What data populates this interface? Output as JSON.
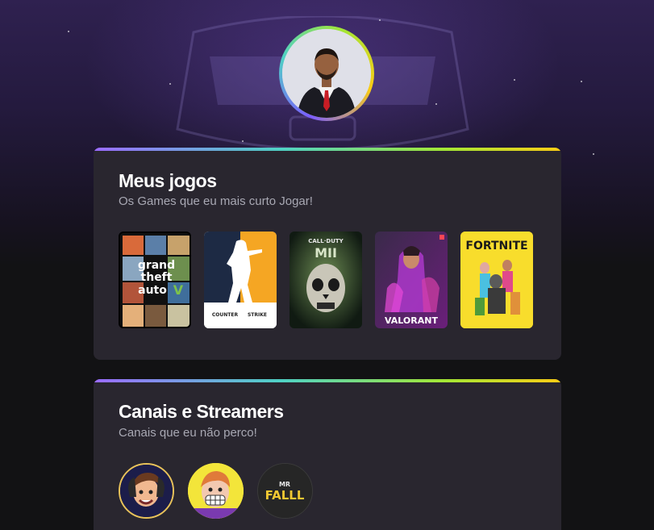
{
  "profile": {
    "avatar_alt": "profile photo"
  },
  "games_section": {
    "title": "Meus jogos",
    "subtitle": "Os Games que eu mais curto Jogar!",
    "games": [
      {
        "name": "gta-v",
        "label": "grand theft auto",
        "icon": "gta-cover"
      },
      {
        "name": "counter-strike",
        "label": "COUNTER STRIKE",
        "icon": "cs-cover"
      },
      {
        "name": "call-of-duty-mw2",
        "label": "CALL OF DUTY MWII",
        "icon": "cod-cover"
      },
      {
        "name": "valorant",
        "label": "VALORANT",
        "icon": "valorant-cover"
      },
      {
        "name": "fortnite",
        "label": "FORTNITE",
        "icon": "fortnite-cover"
      }
    ]
  },
  "streams_section": {
    "title": "Canais e Streamers",
    "subtitle": "Canais que eu não perco!",
    "channels": [
      {
        "name": "streamer-1",
        "icon": "cartoon-avatar"
      },
      {
        "name": "streamer-2",
        "icon": "cartoon-avatar"
      },
      {
        "name": "mr-falll",
        "label": "MR FALLL",
        "icon": "logo"
      }
    ]
  },
  "colors": {
    "accent_gradient": [
      "#9b6bff",
      "#4fd1c5",
      "#a3e635",
      "#facc15"
    ],
    "card_bg": "#29262f",
    "page_bg": "#121214"
  }
}
